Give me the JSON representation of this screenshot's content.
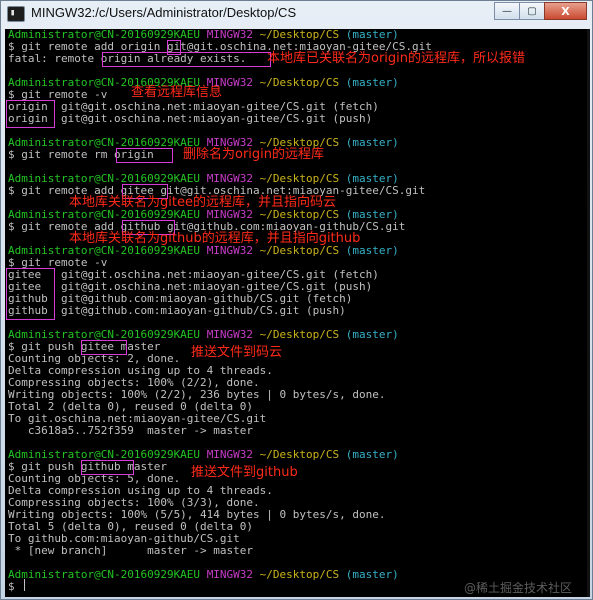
{
  "window": {
    "title": "MINGW32:/c/Users/Administrator/Desktop/CS",
    "icon": "terminal-icon",
    "icon_glyph": "▮",
    "minimize": "—",
    "maximize": "▢",
    "close": "X"
  },
  "prompt": {
    "user": "Administrator@CN-20160929KAEU",
    "env": "MINGW32",
    "path": "~/Desktop/CS",
    "branch": "(master)",
    "sign": "$"
  },
  "console_lines": [
    "$ git remote add origin git@git.oschina.net:miaoyan-gitee/CS.git",
    "fatal: remote origin already exists.",
    "$ git remote -v",
    "origin  git@git.oschina.net:miaoyan-gitee/CS.git (fetch)",
    "origin  git@git.oschina.net:miaoyan-gitee/CS.git (push)",
    "$ git remote rm origin",
    "$ git remote add gitee git@git.oschina.net:miaoyan-gitee/CS.git",
    "$ git remote add github git@github.com:miaoyan-github/CS.git",
    "$ git remote -v",
    "gitee   git@git.oschina.net:miaoyan-gitee/CS.git (fetch)",
    "gitee   git@git.oschina.net:miaoyan-gitee/CS.git (push)",
    "github  git@github.com:miaoyan-github/CS.git (fetch)",
    "github  git@github.com:miaoyan-github/CS.git (push)",
    "$ git push gitee master",
    "Counting objects: 2, done.",
    "Delta compression using up to 4 threads.",
    "Compressing objects: 100% (2/2), done.",
    "Writing objects: 100% (2/2), 236 bytes | 0 bytes/s, done.",
    "Total 2 (delta 0), reused 0 (delta 0)",
    "To git.oschina.net:miaoyan-gitee/CS.git",
    "   c3618a5..752f359  master -> master",
    "$ git push github master",
    "Counting objects: 5, done.",
    "Delta compression using up to 4 threads.",
    "Compressing objects: 100% (3/3), done.",
    "Writing objects: 100% (5/5), 414 bytes | 0 bytes/s, done.",
    "Total 5 (delta 0), reused 0 (delta 0)",
    "To github.com:miaoyan-github/CS.git",
    " * [new branch]      master -> master",
    "$ "
  ],
  "annotations": [
    "本地库已关联名为origin的远程库，所以报错",
    "查看远程库信息",
    "删除名为origin的远程库",
    "本地库关联名为gitee的远程库，并且指向码云",
    "本地库关联名为github的远程库，并且指向github",
    "推送文件到码云",
    "推送文件到github"
  ],
  "watermark": "@稀土掘金技术社区",
  "colors": {
    "user": "#23c423",
    "env": "#c83cc8",
    "path": "#c9b41c",
    "branch": "#35b1c8",
    "annotation": "#ff2a1a",
    "highlight_box": "#d63bd6"
  }
}
